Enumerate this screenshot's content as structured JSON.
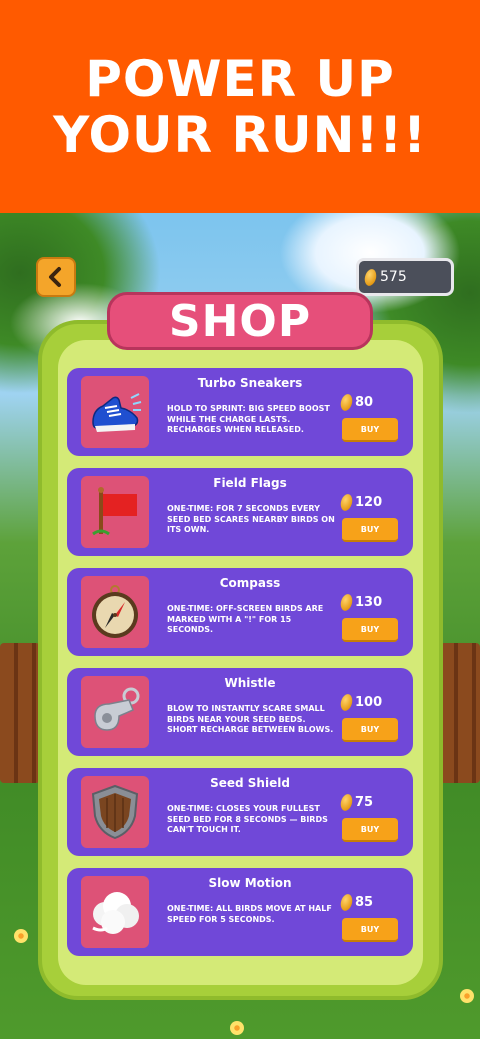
{
  "banner": {
    "title": "POWER UP YOUR RUN!!!"
  },
  "header": {
    "coins": "575"
  },
  "shop": {
    "title": "SHOP",
    "items": [
      {
        "name": "Turbo Sneakers",
        "description": "HOLD TO SPRINT: BIG SPEED BOOST WHILE THE CHARGE LASTS. RECHARGES WHEN RELEASED.",
        "price": "80",
        "buy_label": "BUY",
        "icon": "sneaker-icon"
      },
      {
        "name": "Field Flags",
        "description": "ONE-TIME: FOR 7 SECONDS EVERY SEED BED SCARES NEARBY BIRDS ON ITS OWN.",
        "price": "120",
        "buy_label": "BUY",
        "icon": "flag-icon"
      },
      {
        "name": "Compass",
        "description": "ONE-TIME: OFF-SCREEN BIRDS ARE MARKED WITH A \"!\" FOR 15 SECONDS.",
        "price": "130",
        "buy_label": "BUY",
        "icon": "compass-icon"
      },
      {
        "name": "Whistle",
        "description": "BLOW TO INSTANTLY SCARE SMALL BIRDS NEAR YOUR SEED BEDS. SHORT RECHARGE BETWEEN BLOWS.",
        "price": "100",
        "buy_label": "BUY",
        "icon": "whistle-icon"
      },
      {
        "name": "Seed Shield",
        "description": "ONE-TIME: CLOSES YOUR FULLEST SEED BED FOR 8 SECONDS — BIRDS CAN'T TOUCH IT.",
        "price": "75",
        "buy_label": "BUY",
        "icon": "shield-icon"
      },
      {
        "name": "Slow Motion",
        "description": "ONE-TIME: ALL BIRDS MOVE AT HALF SPEED FOR 5 SECONDS.",
        "price": "85",
        "buy_label": "BUY",
        "icon": "cloud-icon"
      }
    ]
  },
  "colors": {
    "banner": "#ff5a00",
    "card": "#7048d8",
    "buy_button": "#f7a219",
    "title_plate": "#e64f7a",
    "panel": "#a7cf3a"
  }
}
